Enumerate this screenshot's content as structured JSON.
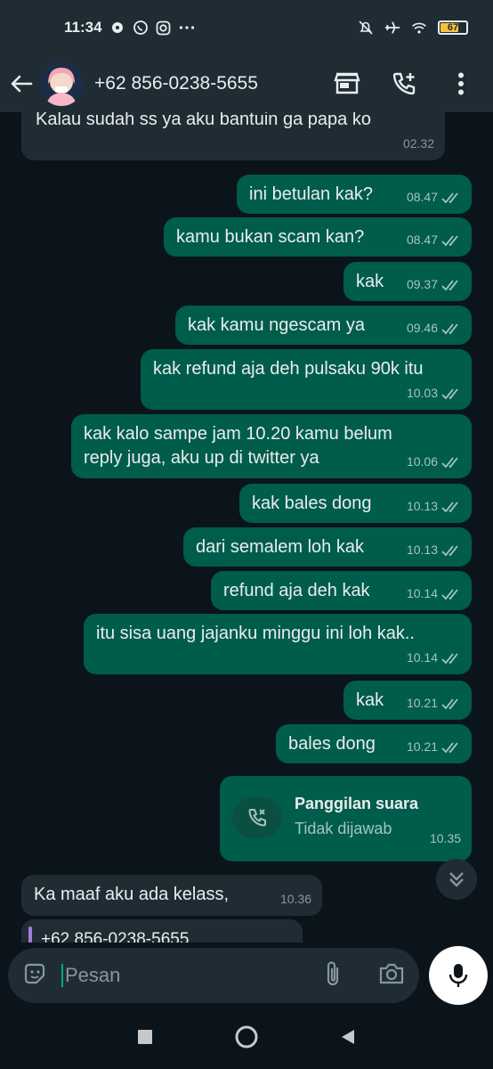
{
  "status_bar": {
    "time": "11:34",
    "battery": "67"
  },
  "header": {
    "contact": "+62 856-0238-5655"
  },
  "messages": [
    {
      "text": "Kalau sudah ss ya aku bantuin ga papa ko",
      "time": "02.32"
    },
    {
      "text": "ini betulan kak?",
      "time": "08.47"
    },
    {
      "text": "kamu bukan scam kan?",
      "time": "08.47"
    },
    {
      "text": "kak",
      "time": "09.37"
    },
    {
      "text": "kak kamu ngescam ya",
      "time": "09.46"
    },
    {
      "text": "kak refund aja deh pulsaku 90k itu",
      "time": "10.03"
    },
    {
      "text_line1": "kak kalo sampe jam 10.20 kamu belum",
      "text_line2": "reply juga, aku up di twitter ya",
      "time": "10.06"
    },
    {
      "text": "kak bales dong",
      "time": "10.13"
    },
    {
      "text": "dari semalem loh kak",
      "time": "10.13"
    },
    {
      "text": "refund aja deh kak",
      "time": "10.14"
    },
    {
      "text": "itu sisa uang jajanku minggu ini loh kak..",
      "time": "10.14"
    },
    {
      "text": "kak",
      "time": "10.21"
    },
    {
      "text": "bales dong",
      "time": "10.21"
    },
    {
      "title": "Panggilan suara",
      "subtitle": "Tidak dijawab",
      "time": "10.35"
    },
    {
      "text": "Ka maaf aku ada  kelass,",
      "time": "10.36"
    },
    {
      "text": "+62 856-0238-5655"
    }
  ],
  "input": {
    "placeholder": "Pesan"
  },
  "colors": {
    "outgoing": "#005c4b",
    "incoming": "#202c33",
    "accent": "#00a884",
    "background": "#0b141a"
  },
  "icons": [
    "back-arrow-icon",
    "store-icon",
    "add-call-icon",
    "more-vert-icon",
    "double-check-icon",
    "missed-call-icon",
    "chevron-double-down-icon",
    "sticker-icon",
    "attach-icon",
    "camera-icon",
    "mic-icon"
  ]
}
